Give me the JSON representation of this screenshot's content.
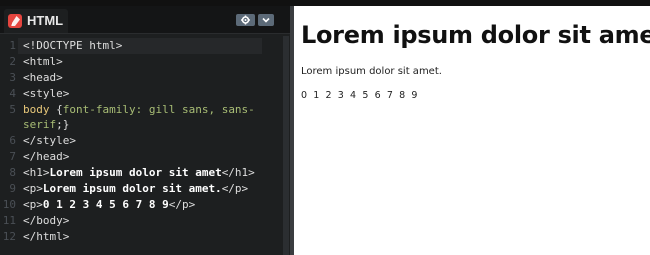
{
  "tab": {
    "label": "HTML",
    "icon": "html-file-icon",
    "icon_color": "#e5453f"
  },
  "toolbar": {
    "settings_icon": "gear-icon",
    "menu_icon": "chevron-down-icon"
  },
  "code_lines": [
    {
      "n": "1",
      "parts": [
        {
          "c": "tag",
          "t": "<!DOCTYPE html>"
        }
      ]
    },
    {
      "n": "2",
      "parts": [
        {
          "c": "tag",
          "t": "<html>"
        }
      ]
    },
    {
      "n": "3",
      "parts": [
        {
          "c": "tag",
          "t": "<head>"
        }
      ]
    },
    {
      "n": "4",
      "parts": [
        {
          "c": "tag",
          "t": "<style>"
        }
      ]
    },
    {
      "n": "5",
      "parts": [
        {
          "c": "sel",
          "t": "body "
        },
        {
          "c": "tag",
          "t": "{"
        },
        {
          "c": "prop",
          "t": "font-family: gill sans, sans-"
        }
      ]
    },
    {
      "n": "",
      "parts": [
        {
          "c": "prop",
          "t": "serif"
        },
        {
          "c": "tag",
          "t": ";}"
        }
      ]
    },
    {
      "n": "6",
      "parts": [
        {
          "c": "tag",
          "t": "</style>"
        }
      ]
    },
    {
      "n": "7",
      "parts": [
        {
          "c": "tag",
          "t": "</head>"
        }
      ]
    },
    {
      "n": "8",
      "parts": [
        {
          "c": "tag",
          "t": "<h1>"
        },
        {
          "c": "txt",
          "t": "Lorem ipsum dolor sit amet"
        },
        {
          "c": "tag",
          "t": "</h1>"
        }
      ]
    },
    {
      "n": "9",
      "parts": [
        {
          "c": "tag",
          "t": "<p>"
        },
        {
          "c": "txt",
          "t": "Lorem ipsum dolor sit amet."
        },
        {
          "c": "tag",
          "t": "</p>"
        }
      ]
    },
    {
      "n": "10",
      "parts": [
        {
          "c": "tag",
          "t": "<p>"
        },
        {
          "c": "txt",
          "t": "0 1 2 3 4 5 6 7 8 9"
        },
        {
          "c": "tag",
          "t": "</p>"
        }
      ]
    },
    {
      "n": "11",
      "parts": [
        {
          "c": "tag",
          "t": "</body>"
        }
      ]
    },
    {
      "n": "12",
      "parts": [
        {
          "c": "tag",
          "t": "</html>"
        }
      ]
    }
  ],
  "preview": {
    "heading": "Lorem ipsum dolor sit amet",
    "paragraph": "Lorem ipsum dolor sit amet.",
    "digits": "0 1 2 3 4 5 6 7 8 9"
  }
}
